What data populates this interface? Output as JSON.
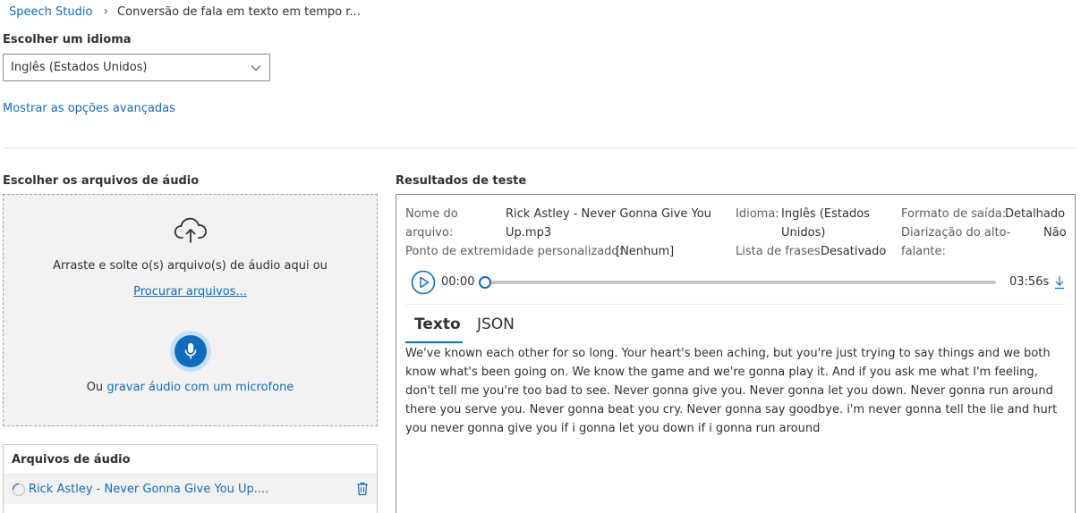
{
  "breadcrumb": {
    "root": "Speech Studio",
    "current": "Conversão de fala em texto em tempo r..."
  },
  "language": {
    "label": "Escolher um idioma",
    "selected": "Inglês (Estados Unidos)"
  },
  "advanced_link": "Mostrar as opções avançadas",
  "audio_section": {
    "label": "Escolher os arquivos de áudio",
    "drop_text": "Arraste e solte o(s) arquivo(s) de áudio aqui ou",
    "browse_link": "Procurar arquivos...",
    "mic_prefix": "Ou",
    "mic_link": "gravar áudio com um microfone"
  },
  "files_panel": {
    "title": "Arquivos de áudio",
    "items": [
      {
        "name": "Rick Astley - Never Gonna Give You Up...."
      }
    ]
  },
  "results": {
    "title": "Resultados de teste",
    "file_name_label_1": "Nome do",
    "file_name_label_2": "arquivo:",
    "file_name_value_1": "Rick Astley - Never Gonna Give You",
    "file_name_value_2": "Up.mp3",
    "language_label": "Idioma:",
    "language_value_1": "Inglês (Estados",
    "language_value_2": "Unidos)",
    "output_format_label": "Formato de saída:",
    "output_format_value": "Detalhado",
    "diarization_label_1": "Diarização do alto-",
    "diarization_label_2": "falante:",
    "diarization_value": "Não",
    "endpoint_label": "Ponto de extremidade personalizado:",
    "endpoint_value": "[Nenhum]",
    "phrase_list_label": "Lista de frases:",
    "phrase_list_value": "Desativado",
    "player": {
      "current_time": "00:00",
      "duration": "03:56s",
      "progress": 0
    },
    "tabs": [
      "Texto",
      "JSON"
    ],
    "active_tab": "Texto",
    "transcript": "We've known each other for so long. Your heart's been aching, but you're just trying to say things and we both know what's been going on. We know the game and we're gonna play it. And if you ask me what I'm feeling, don't tell me you're too bad to see. Never gonna give you. Never gonna let you down. Never gonna run around there you serve you. Never gonna beat you cry. Never gonna say goodbye. i'm never gonna tell the lie and hurt you never gonna give you if i gonna let you down if i gonna run around"
  },
  "colors": {
    "accent": "#0f6cbd",
    "dropzone_bg": "#f3f2f1"
  }
}
